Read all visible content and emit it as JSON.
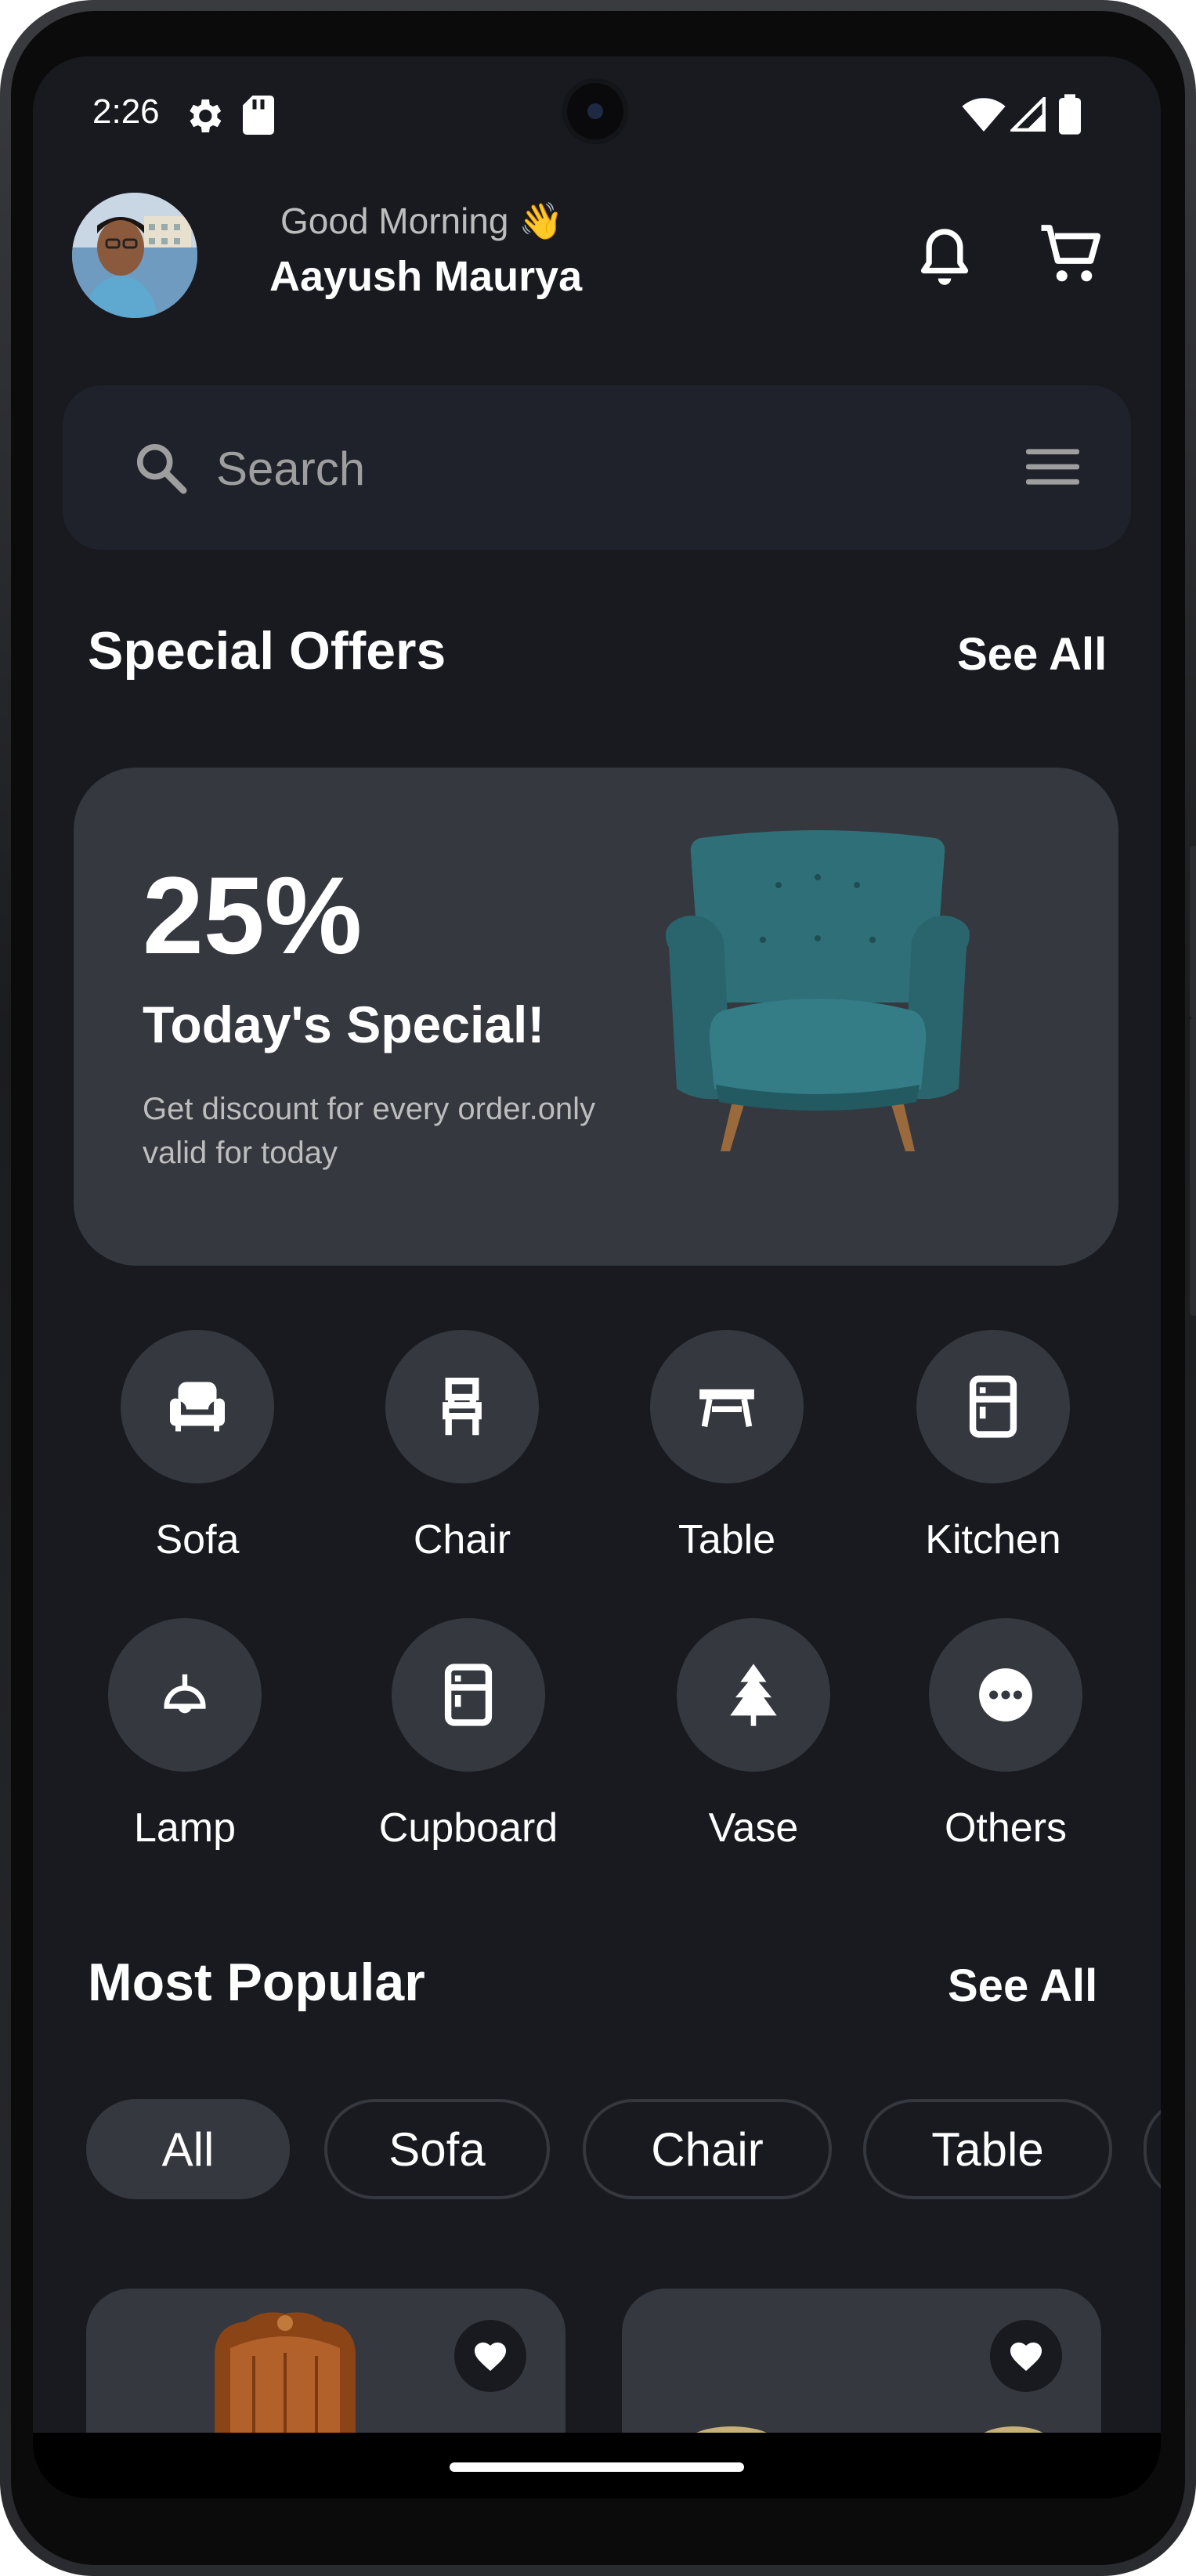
{
  "status_bar": {
    "time": "2:26"
  },
  "header": {
    "greeting": "Good Morning 👋",
    "user_name": "Aayush Maurya"
  },
  "search": {
    "placeholder": "Search"
  },
  "special_offers": {
    "title": "Special Offers",
    "see_all": "See All",
    "banner": {
      "percent": "25%",
      "headline": "Today's Special!",
      "description": "Get discount for every order.only valid for today",
      "chair_color": "#2e6f78"
    }
  },
  "categories": [
    {
      "label": "Sofa",
      "icon": "sofa-icon"
    },
    {
      "label": "Chair",
      "icon": "chair-icon"
    },
    {
      "label": "Table",
      "icon": "table-icon"
    },
    {
      "label": "Kitchen",
      "icon": "kitchen-icon"
    },
    {
      "label": "Lamp",
      "icon": "lamp-icon"
    },
    {
      "label": "Cupboard",
      "icon": "cupboard-icon"
    },
    {
      "label": "Vase",
      "icon": "vase-icon"
    },
    {
      "label": "Others",
      "icon": "more-icon"
    }
  ],
  "most_popular": {
    "title": "Most Popular",
    "see_all": "See All",
    "filters": [
      "All",
      "Sofa",
      "Chair",
      "Table"
    ],
    "selected_filter": "All"
  },
  "colors": {
    "background": "#181a20",
    "surface": "#35383f",
    "search_surface": "#1f222a",
    "text_primary": "#ffffff",
    "text_secondary": "#bdbdbd"
  }
}
